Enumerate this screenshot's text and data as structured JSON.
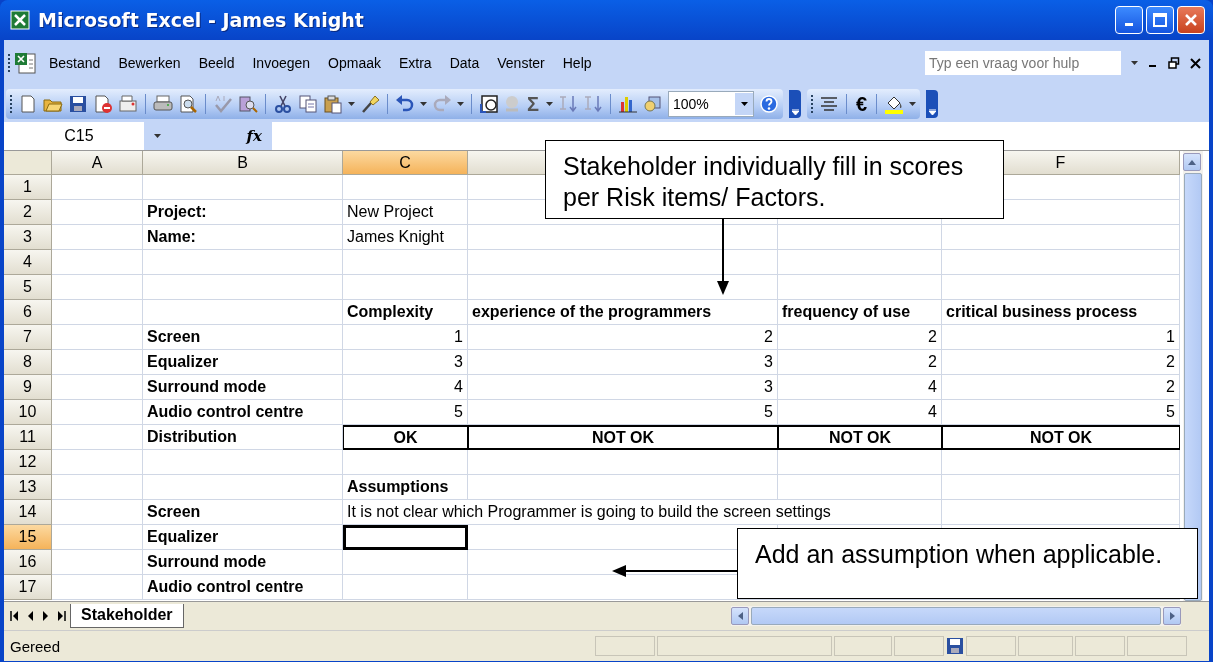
{
  "window": {
    "title": "Microsoft Excel - James Knight"
  },
  "menu": [
    "Bestand",
    "Bewerken",
    "Beeld",
    "Invoegen",
    "Opmaak",
    "Extra",
    "Data",
    "Venster",
    "Help"
  ],
  "help_box": {
    "placeholder": "Typ een vraag voor hulp"
  },
  "toolbar": {
    "autosum_symbol": "Σ",
    "zoom": "100%",
    "currency_symbol": "€"
  },
  "formula_bar": {
    "name_box": "C15",
    "function_label": "fx"
  },
  "columns": [
    {
      "label": "A",
      "selected": false
    },
    {
      "label": "B",
      "selected": false
    },
    {
      "label": "C",
      "selected": true
    },
    {
      "selected": false
    },
    {
      "label": "F",
      "selected": false
    }
  ],
  "rows": [
    {
      "number": "1",
      "selected": false,
      "kind": "plain"
    },
    {
      "number": "2",
      "selected": false,
      "kind": "plain",
      "b": "Project:",
      "c": "New Project"
    },
    {
      "number": "3",
      "selected": false,
      "kind": "plain",
      "b": "Name:",
      "c": "James Knight"
    },
    {
      "number": "4",
      "selected": false,
      "kind": "plain"
    },
    {
      "number": "5",
      "selected": false,
      "kind": "plain"
    },
    {
      "number": "6",
      "selected": false,
      "kind": "header",
      "c": "Complexity",
      "d": "experience of the programmers",
      "e": "frequency of use",
      "f": "critical business process"
    },
    {
      "number": "7",
      "selected": false,
      "kind": "numbers",
      "b": "Screen",
      "c": "1",
      "d": "2",
      "e": "2",
      "f": "1"
    },
    {
      "number": "8",
      "selected": false,
      "kind": "numbers",
      "b": "Equalizer",
      "c": "3",
      "d": "3",
      "e": "2",
      "f": "2"
    },
    {
      "number": "9",
      "selected": false,
      "kind": "numbers",
      "b": "Surround mode",
      "c": "4",
      "d": "3",
      "e": "4",
      "f": "2"
    },
    {
      "number": "10",
      "selected": false,
      "kind": "numbers",
      "b": "Audio control centre",
      "c": "5",
      "d": "5",
      "e": "4",
      "f": "5"
    },
    {
      "number": "11",
      "selected": false,
      "kind": "result",
      "b": "Distribution",
      "c": "OK",
      "d": "NOT OK",
      "e": "NOT OK",
      "f": "NOT OK"
    },
    {
      "number": "12",
      "selected": false,
      "kind": "plain"
    },
    {
      "number": "13",
      "selected": false,
      "kind": "header",
      "c": "Assumptions"
    },
    {
      "number": "14",
      "selected": false,
      "kind": "plain",
      "b": "Screen",
      "c": "It is not clear which Programmer is going to build the screen settings"
    },
    {
      "number": "15",
      "selected": true,
      "kind": "plain",
      "b": "Equalizer"
    },
    {
      "number": "16",
      "selected": false,
      "kind": "plain",
      "b": "Surround mode"
    },
    {
      "number": "17",
      "selected": false,
      "kind": "plain",
      "b": "Audio control centre"
    }
  ],
  "callouts": [
    {
      "text": "Stakeholder individually fill in scores per Risk items/ Factors.",
      "kind": "down"
    },
    {
      "text": "Add an assumption when applicable.",
      "kind": "left"
    }
  ],
  "sheet_tabs": [
    {
      "label": "Stakeholder",
      "selected": true
    }
  ],
  "status_bar": {
    "text": "Gereed"
  }
}
